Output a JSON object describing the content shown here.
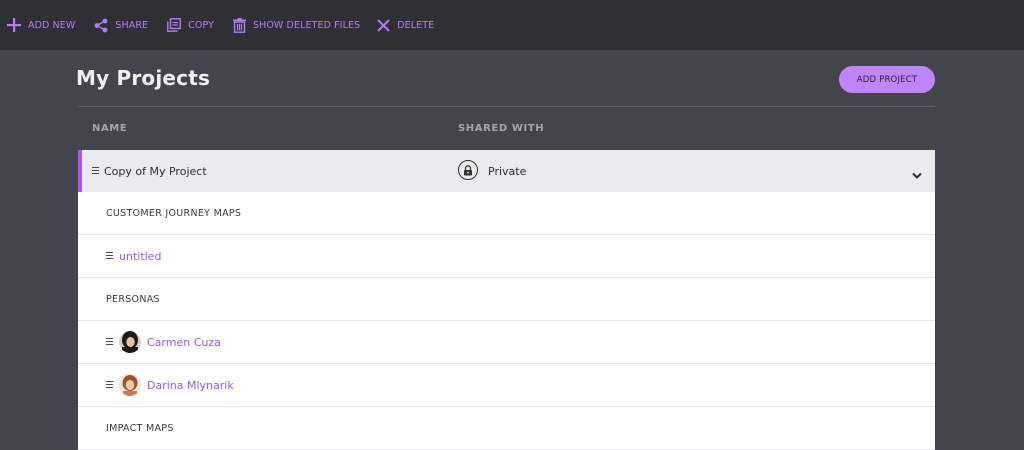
{
  "toolbar": {
    "add_new": "ADD NEW",
    "share": "SHARE",
    "copy": "COPY",
    "show_deleted": "SHOW DELETED FILES",
    "delete": "DELETE"
  },
  "page": {
    "title": "My Projects",
    "add_project": "ADD PROJECT"
  },
  "columns": {
    "name": "NAME",
    "shared_with": "SHARED WITH"
  },
  "project": {
    "name": "Copy of My Project",
    "sharing": "Private"
  },
  "rows": [
    {
      "type": "section",
      "label": "CUSTOMER JOURNEY MAPS"
    },
    {
      "type": "item",
      "label": "untitled"
    },
    {
      "type": "section",
      "label": "PERSONAS"
    },
    {
      "type": "item",
      "label": "Carmen Cuza",
      "icon": "avatar"
    },
    {
      "type": "item",
      "label": "Darina Mlynarik",
      "icon": "avatar"
    },
    {
      "type": "section",
      "label": "IMPACT MAPS"
    }
  ],
  "colors": {
    "accent": "#c084fc",
    "link": "#9b5ad9",
    "toolbar_bg": "#2f3035",
    "page_bg": "#44454c"
  }
}
